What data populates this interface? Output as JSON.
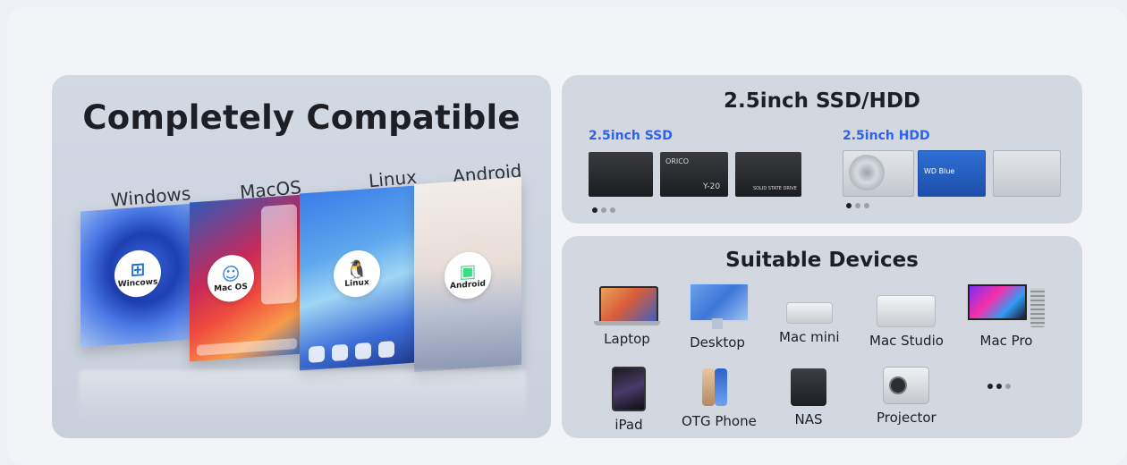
{
  "compat": {
    "title": "Completely Compatible",
    "systems": [
      {
        "label": "Windows",
        "logo_text": "Wincows",
        "icon": "windows-icon"
      },
      {
        "label": "MacOS",
        "logo_text": "Mac OS",
        "icon": "finder-icon"
      },
      {
        "label": "Linux",
        "logo_text": "Linux",
        "icon": "tux-penguin-icon"
      },
      {
        "label": "Android",
        "logo_text": "Android",
        "icon": "android-robot-icon"
      }
    ]
  },
  "storage": {
    "title": "2.5inch SSD/HDD",
    "ssd_label": "2.5inch SSD",
    "hdd_label": "2.5inch HDD",
    "ssd_drives": [
      {
        "text": ""
      },
      {
        "text": "ORICO",
        "model": "Y-20"
      },
      {
        "text": "SOLID STATE DRIVE"
      }
    ],
    "hdd_drives": [
      {
        "text": ""
      },
      {
        "text": "WD Blue"
      },
      {
        "text": ""
      }
    ],
    "accent_color": "#2f63e6"
  },
  "devices": {
    "title": "Suitable Devices",
    "items": [
      {
        "label": "Laptop",
        "icon": "laptop-icon"
      },
      {
        "label": "Desktop",
        "icon": "desktop-icon"
      },
      {
        "label": "Mac mini",
        "icon": "mac-mini-icon"
      },
      {
        "label": "Mac Studio",
        "icon": "mac-studio-icon"
      },
      {
        "label": "Mac Pro",
        "icon": "mac-pro-icon"
      },
      {
        "label": "iPad",
        "icon": "ipad-icon"
      },
      {
        "label": "OTG Phone",
        "icon": "phone-icon"
      },
      {
        "label": "NAS",
        "icon": "nas-icon"
      },
      {
        "label": "Projector",
        "icon": "projector-icon"
      }
    ]
  }
}
